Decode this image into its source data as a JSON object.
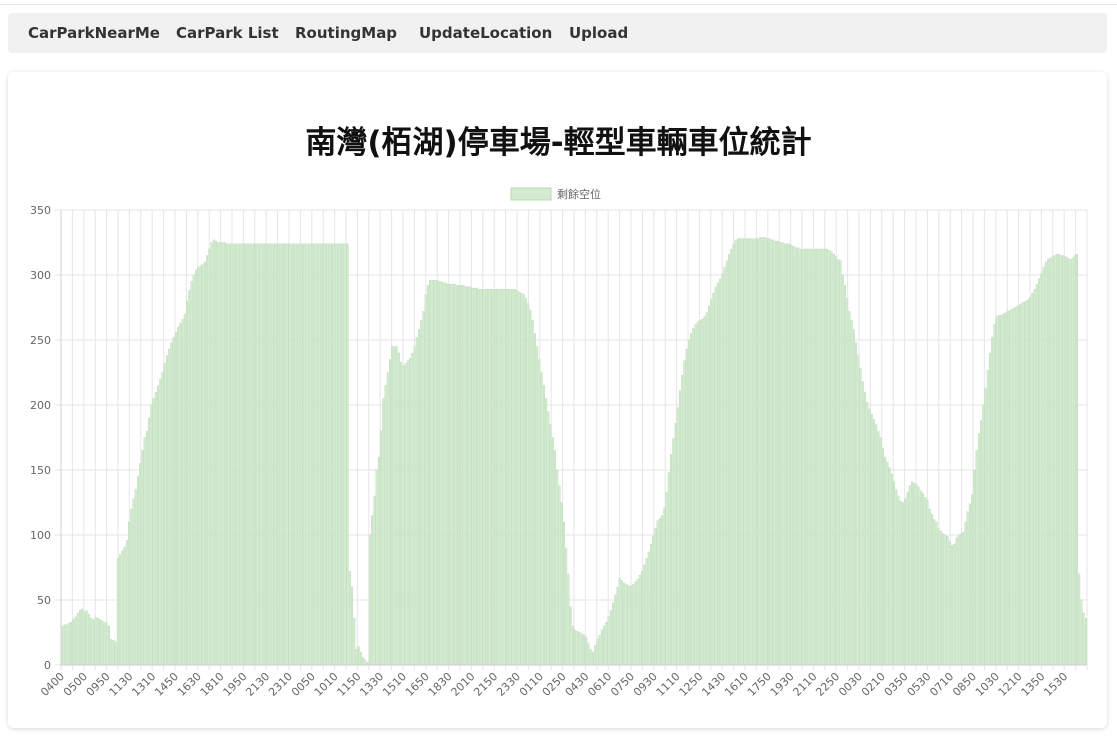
{
  "navbar": {
    "items": [
      {
        "label": "CarParkNearMe"
      },
      {
        "label": "CarPark List"
      },
      {
        "label": "RoutingMap"
      },
      {
        "label": "UpdateLocation"
      },
      {
        "label": "Upload"
      }
    ]
  },
  "colors": {
    "bar_fill": "#d4ead1",
    "bar_stroke": "#b7dbb3",
    "grid": "#e5e5e5",
    "navbar_bg": "#f1f1f1"
  },
  "chart_data": {
    "type": "bar",
    "title": "南灣(栢湖)停車場-輕型車輛車位統計",
    "legend": {
      "label": "剩餘空位",
      "position": "top"
    },
    "ylim": [
      0,
      350
    ],
    "y_ticks": [
      0,
      50,
      100,
      150,
      200,
      250,
      300,
      350
    ],
    "grid": true,
    "x_tick_labels": [
      "0400",
      "0500",
      "0950",
      "1130",
      "1310",
      "1450",
      "1630",
      "1810",
      "1950",
      "2130",
      "2310",
      "0050",
      "1010",
      "1150",
      "1330",
      "1510",
      "1650",
      "1830",
      "2010",
      "2150",
      "2330",
      "0110",
      "0250",
      "0430",
      "0610",
      "0750",
      "0930",
      "1110",
      "1250",
      "1430",
      "1610",
      "1750",
      "1930",
      "2110",
      "2250",
      "0030",
      "0210",
      "0350",
      "0530",
      "0710",
      "0850",
      "1030",
      "1210",
      "1350",
      "1530"
    ],
    "series": [
      {
        "name": "剩餘空位",
        "values": [
          30,
          31,
          31,
          32,
          33,
          35,
          37,
          40,
          42,
          43,
          41,
          42,
          39,
          36,
          35,
          37,
          36,
          35,
          34,
          33,
          32,
          30,
          20,
          19,
          18,
          82,
          85,
          88,
          91,
          96,
          110,
          120,
          128,
          135,
          145,
          155,
          165,
          175,
          180,
          190,
          200,
          205,
          210,
          215,
          220,
          225,
          232,
          238,
          243,
          248,
          252,
          256,
          260,
          263,
          266,
          270,
          280,
          288,
          295,
          300,
          304,
          306,
          307,
          308,
          310,
          315,
          320,
          325,
          327,
          326,
          325,
          325,
          325,
          325,
          324,
          324,
          324,
          324,
          324,
          324,
          324,
          324,
          324,
          324,
          324,
          324,
          324,
          324,
          324,
          324,
          324,
          324,
          324,
          324,
          324,
          324,
          324,
          324,
          324,
          324,
          324,
          324,
          324,
          324,
          324,
          324,
          324,
          324,
          324,
          324,
          324,
          324,
          324,
          324,
          324,
          324,
          324,
          324,
          324,
          324,
          324,
          324,
          324,
          324,
          324,
          324,
          324,
          324,
          324,
          72,
          60,
          36,
          12,
          14,
          10,
          6,
          4,
          2,
          100,
          115,
          130,
          150,
          160,
          180,
          205,
          215,
          225,
          235,
          245,
          245,
          245,
          240,
          233,
          230,
          232,
          234,
          236,
          240,
          245,
          252,
          258,
          265,
          272,
          285,
          292,
          296,
          296,
          296,
          296,
          295,
          295,
          294,
          294,
          293,
          293,
          293,
          293,
          292,
          292,
          292,
          292,
          291,
          291,
          291,
          290,
          290,
          290,
          289,
          289,
          289,
          289,
          289,
          289,
          289,
          289,
          289,
          289,
          289,
          289,
          289,
          289,
          289,
          289,
          289,
          288,
          287,
          286,
          285,
          282,
          278,
          273,
          265,
          255,
          245,
          235,
          225,
          215,
          205,
          195,
          185,
          175,
          165,
          150,
          138,
          125,
          110,
          90,
          70,
          45,
          30,
          27,
          26,
          25,
          24,
          23,
          21,
          17,
          12,
          10,
          15,
          20,
          23,
          27,
          30,
          33,
          37,
          42,
          48,
          54,
          60,
          67,
          65,
          63,
          62,
          61,
          61,
          62,
          64,
          66,
          69,
          72,
          77,
          82,
          87,
          93,
          99,
          105,
          111,
          113,
          115,
          121,
          133,
          148,
          162,
          174,
          186,
          198,
          211,
          223,
          234,
          243,
          250,
          255,
          259,
          262,
          264,
          265,
          266,
          268,
          271,
          276,
          281,
          286,
          291,
          294,
          297,
          301,
          306,
          311,
          316,
          320,
          324,
          327,
          328,
          328,
          328,
          328,
          328,
          328,
          328,
          328,
          328,
          328,
          329,
          329,
          329,
          328,
          328,
          327,
          327,
          326,
          326,
          325,
          325,
          324,
          324,
          324,
          323,
          322,
          321,
          321,
          320,
          320,
          320,
          320,
          320,
          320,
          320,
          320,
          320,
          320,
          320,
          320,
          320,
          319,
          318,
          316,
          314,
          312,
          311,
          300,
          292,
          282,
          272,
          265,
          258,
          248,
          238,
          228,
          218,
          210,
          202,
          197,
          193,
          189,
          185,
          180,
          175,
          167,
          160,
          156,
          152,
          147,
          141,
          135,
          130,
          126,
          125,
          128,
          133,
          138,
          141,
          140,
          139,
          137,
          134,
          132,
          129,
          127,
          120,
          116,
          112,
          110,
          105,
          103,
          101,
          100,
          99,
          95,
          92,
          93,
          98,
          100,
          101,
          102,
          110,
          118,
          124,
          131,
          150,
          165,
          178,
          188,
          200,
          213,
          227,
          240,
          252,
          262,
          268,
          269,
          269,
          270,
          271,
          272,
          273,
          274,
          275,
          276,
          277,
          278,
          279,
          280,
          281,
          283,
          286,
          289,
          293,
          297,
          301,
          306,
          310,
          312,
          313,
          314,
          315,
          316,
          316,
          315,
          315,
          314,
          313,
          312,
          313,
          315,
          316,
          70,
          50,
          40,
          36
        ]
      }
    ]
  }
}
